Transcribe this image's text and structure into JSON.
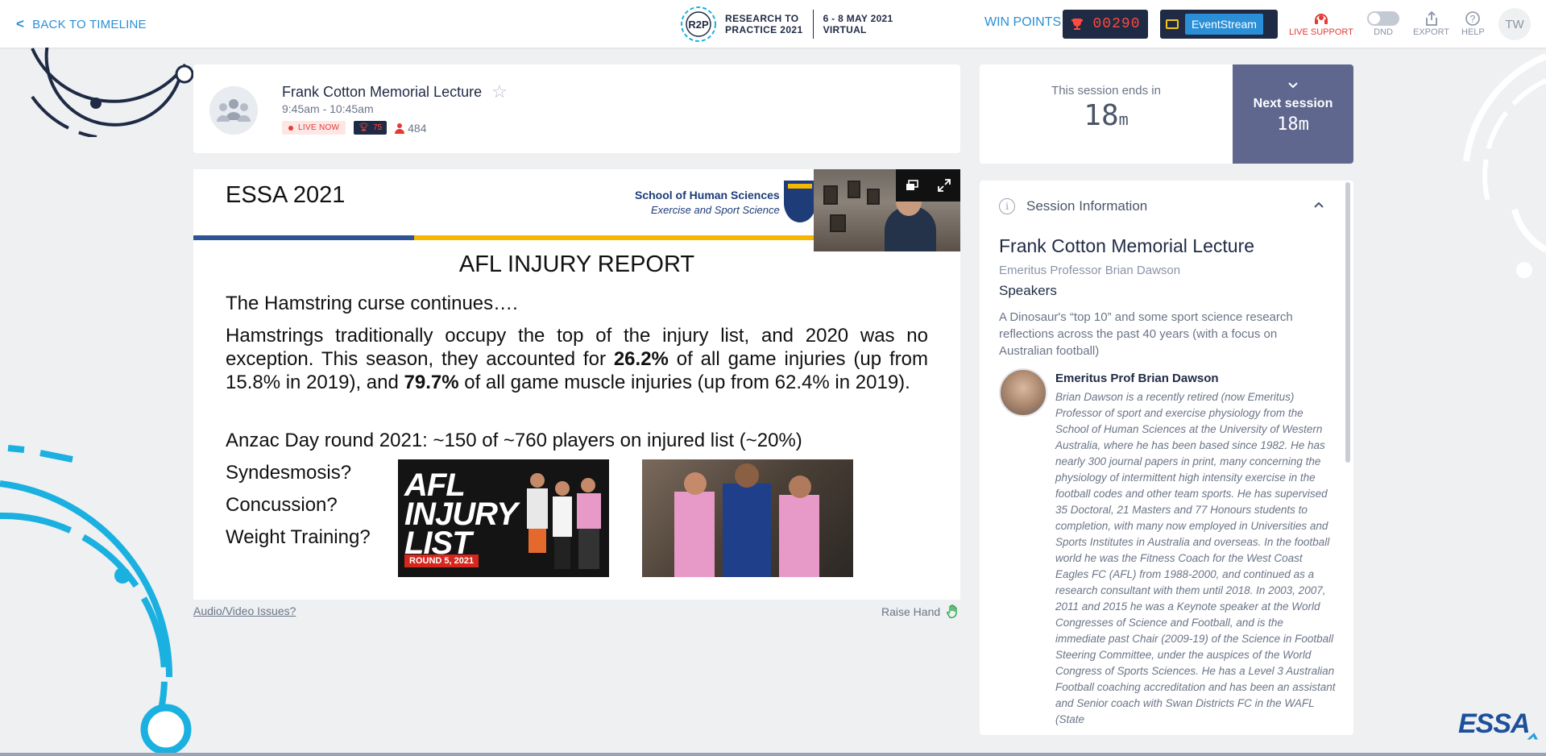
{
  "topbar": {
    "back_label": "BACK TO TIMELINE",
    "brand_line1": "RESEARCH TO",
    "brand_line2": "PRACTICE 2021",
    "brand_date": "6 - 8 MAY 2021",
    "brand_mode": "VIRTUAL",
    "win_points_label": "WIN POINTS",
    "win_points_value": "00290",
    "eventstream_label": "EventStream",
    "live_support_label": "LIVE SUPPORT",
    "dnd_label": "DND",
    "export_label": "EXPORT",
    "help_label": "HELP",
    "user_initials": "TW"
  },
  "session": {
    "title": "Frank Cotton Memorial Lecture",
    "time": "9:45am - 10:45am",
    "live_label": "LIVE NOW",
    "points": "75",
    "attendees": "484"
  },
  "slide": {
    "org": "ESSA 2021",
    "school": "School of Human Sciences",
    "department": "Exercise and Sport Science",
    "heading": "AFL INJURY REPORT",
    "line1": "The Hamstring curse continues….",
    "para_a": "Hamstrings traditionally occupy the top of the injury list, and 2020 was no exception. This season, they accounted for ",
    "para_b": "26.2%",
    "para_c": " of all game injuries (up from 15.8% in 2019), and ",
    "para_d": "79.7%",
    "para_e": " of all game muscle injuries (up from 62.4% in 2019).",
    "line3": "Anzac Day round 2021: ~150 of ~760 players on injured list (~20%)",
    "q1": "Syndesmosis?",
    "q2": "Concussion?",
    "q3": "Weight Training?",
    "img1_line1": "AFL",
    "img1_line2": "INJURY",
    "img1_line3": "LIST",
    "img1_round": "ROUND 5, 2021"
  },
  "below_slide": {
    "av_issues": "Audio/Video Issues?",
    "raise_hand": "Raise Hand"
  },
  "timer": {
    "ends_label": "This session ends in",
    "ends_value": "18",
    "ends_unit": "m",
    "next_label": "Next session",
    "next_value": "18",
    "next_unit": "m"
  },
  "info": {
    "header": "Session Information",
    "title": "Frank Cotton Memorial Lecture",
    "presenter": "Emeritus Professor Brian Dawson",
    "speakers_heading": "Speakers",
    "description": "A Dinosaur's “top 10” and some sport science research reflections across the past 40 years (with a focus on Australian football)",
    "speaker_name": "Emeritus Prof Brian Dawson",
    "speaker_bio": "Brian Dawson is a recently retired (now Emeritus) Professor of sport and exercise physiology from the School of Human Sciences at the University of Western Australia, where he has been based since 1982. He has nearly 300 journal papers in print, many concerning the physiology of intermittent high intensity exercise in the football codes and other team sports. He has supervised 35 Doctoral, 21 Masters and 77 Honours students to completion, with many now employed in Universities and Sports Institutes in Australia and overseas. In the football world he was the Fitness Coach for the West Coast Eagles FC (AFL) from 1988-2000, and continued as a research consultant with them until 2018. In 2003, 2007, 2011 and 2015 he was a Keynote speaker at the World Congresses of Science and Football, and is the immediate past Chair (2009-19) of the Science in Football Steering Committee, under the auspices of the World Congress of Sports Sciences. He has a Level 3 Australian Football coaching accreditation and has been an assistant and Senior coach with Swan Districts FC in the WAFL (State"
  },
  "footer": {
    "logo_a": "ESSA",
    "logo_b": ""
  },
  "colors": {
    "accent": "#2a8fd6",
    "navy": "#1f2a44",
    "live_red": "#e53935",
    "next_session_bg": "#5f678f",
    "deco_cyan": "#1ab0e0"
  }
}
